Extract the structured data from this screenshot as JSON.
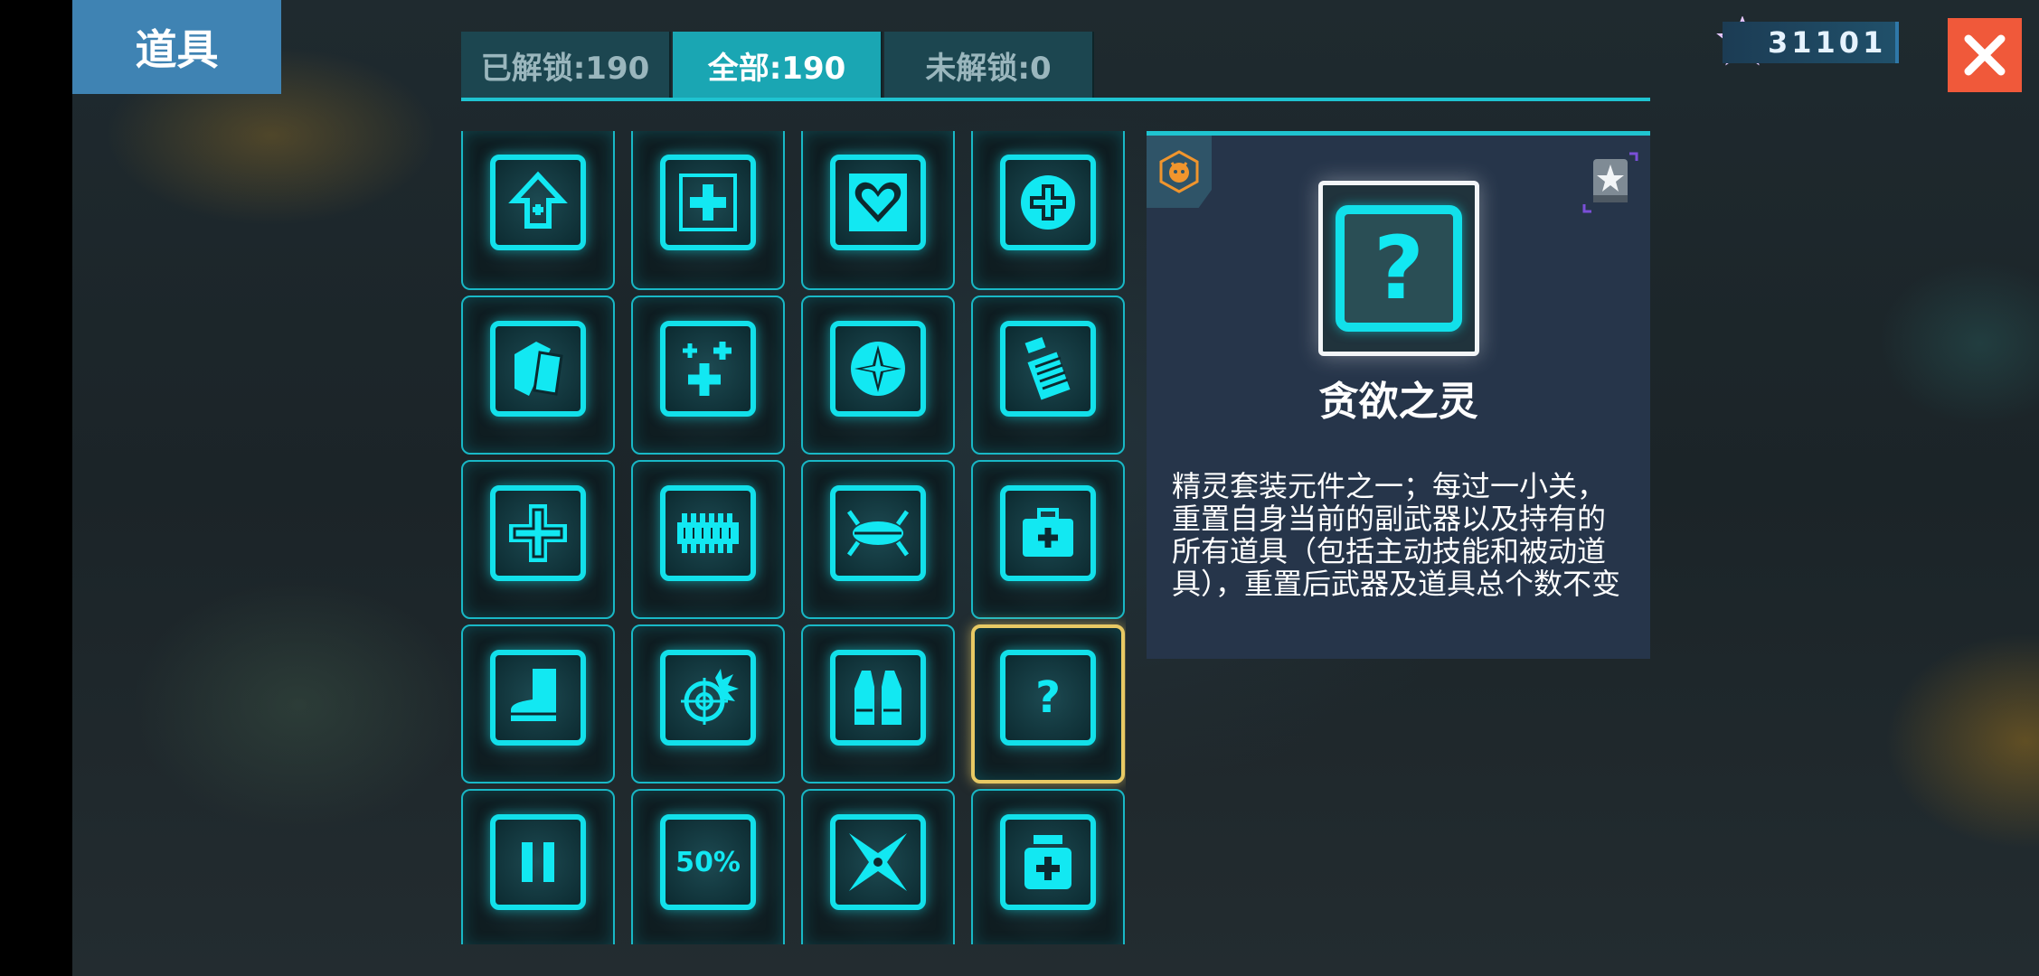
{
  "header": {
    "title": "道具"
  },
  "tabs": [
    {
      "label": "已解锁:190"
    },
    {
      "label": "全部:190"
    },
    {
      "label": "未解锁:0"
    }
  ],
  "currency": {
    "value": "31101",
    "icon": "purple-star-gem-icon"
  },
  "close": {
    "label": "✕"
  },
  "items": [
    {
      "icon": "up-arrow-cross-icon"
    },
    {
      "icon": "medkit-cross-icon"
    },
    {
      "icon": "heart-icon"
    },
    {
      "icon": "circle-cross-icon"
    },
    {
      "icon": "cards-icon"
    },
    {
      "icon": "multi-cross-icon"
    },
    {
      "icon": "compass-icon"
    },
    {
      "icon": "battery-icon"
    },
    {
      "icon": "big-cross-icon"
    },
    {
      "icon": "bullet-belt-icon"
    },
    {
      "icon": "capsule-icon"
    },
    {
      "icon": "first-aid-kit-icon"
    },
    {
      "icon": "boot-icon"
    },
    {
      "icon": "crosshair-icon"
    },
    {
      "icon": "vest-icon"
    },
    {
      "icon": "question-mark-icon",
      "glyph": "?"
    },
    {
      "icon": "pause-icon"
    },
    {
      "icon": "percent-50-icon",
      "glyph": "50%"
    },
    {
      "icon": "shuriken-icon"
    },
    {
      "icon": "medicine-jar-icon"
    }
  ],
  "selected_index": 15,
  "detail": {
    "name": "贪欲之灵",
    "preview_glyph": "?",
    "description": "精灵套装元件之一；每过一小关，重置自身当前的副武器以及持有的所有道具（包括主动技能和被动道具），重置后武器及道具总个数不变"
  },
  "colors": {
    "accent": "#1fc4d1",
    "icon": "#12e0ea",
    "selected_border": "#e8c964",
    "title_tab": "#3f83b3",
    "close": "#f0593a",
    "panel": "#26354a"
  }
}
